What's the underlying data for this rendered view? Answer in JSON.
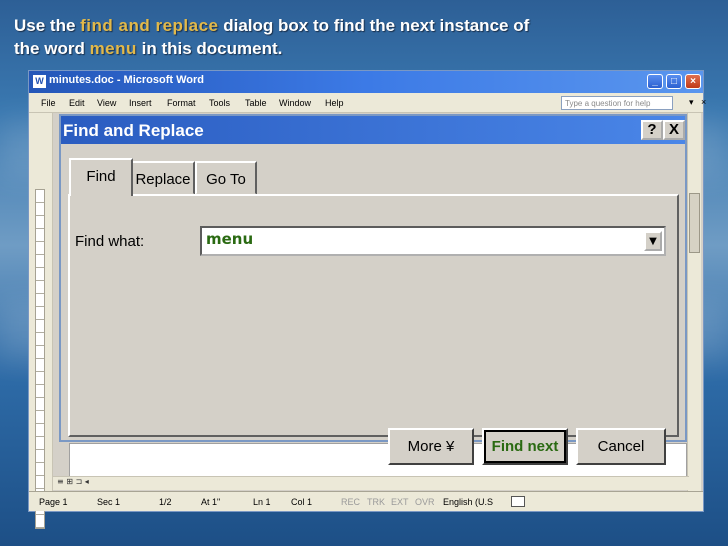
{
  "caption": {
    "line1_pre": "Use the ",
    "line1_hl": "find and replace",
    "line1_post": " dialog box to find the next instance of",
    "line2_pre": "the word ",
    "line2_hl": "menu",
    "line2_post": " in this document."
  },
  "window": {
    "title": "minutes.doc - Microsoft Word",
    "app_icon_glyph": "W",
    "menus": [
      "File",
      "Edit",
      "View",
      "Insert",
      "Format",
      "Tools",
      "Table",
      "Window",
      "Help"
    ],
    "help_placeholder": "Type a question for help",
    "menu_arrow": "▾",
    "menu_close": "×"
  },
  "dialog": {
    "title": "Find and Replace",
    "help_btn": "?",
    "close_btn": "X",
    "tabs": [
      "Find",
      "Replace",
      "Go To"
    ],
    "active_tab": "Find",
    "find_label": "Find what:",
    "find_value": "menu",
    "drop_arrow": "▼",
    "buttons": {
      "more": "More ¥",
      "find_next": "Find next",
      "cancel": "Cancel"
    }
  },
  "statusbar": {
    "page": "Page 1",
    "sec": "Sec 1",
    "pages": "1/2",
    "at": "At 1\"",
    "ln": "Ln 1",
    "col": "Col 1",
    "rec": "REC",
    "trk": "TRK",
    "ext": "EXT",
    "ovr": "OVR",
    "lang": "English (U.S"
  },
  "colors": {
    "title_blue": "#2a5cc0",
    "highlight": "#e2b94a",
    "find_text": "#2a6a12"
  }
}
